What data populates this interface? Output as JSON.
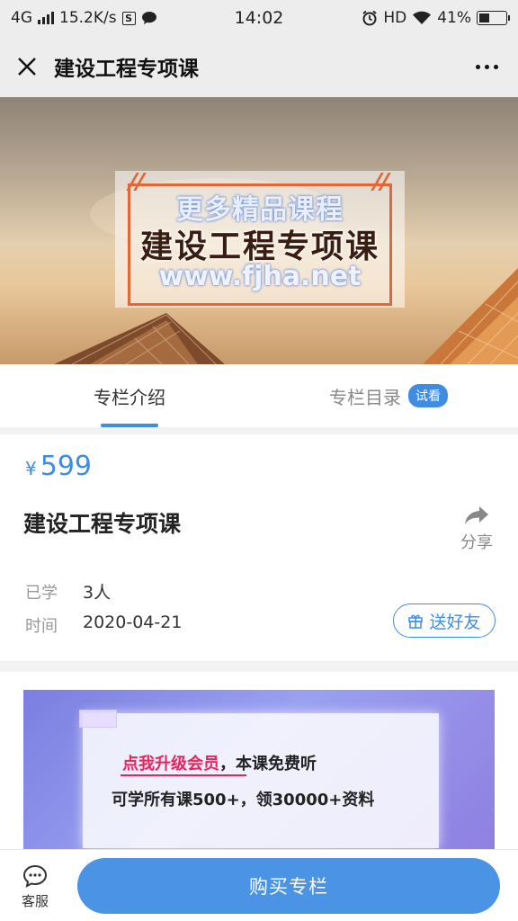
{
  "status_bar": {
    "network": "4G",
    "speed": "15.2K/s",
    "s_icon_label": "S",
    "time": "14:02",
    "hd": "HD",
    "battery": "41%",
    "battery_level": 0.41
  },
  "nav": {
    "title": "建设工程专项课"
  },
  "banner": {
    "line1": "更多精品课程",
    "line2": "建设工程专项课",
    "line3": "www.fjha.net"
  },
  "tabs": {
    "intro": "专栏介绍",
    "catalog": "专栏目录",
    "trial_badge": "试看"
  },
  "course": {
    "currency": "¥",
    "price": "599",
    "title": "建设工程专项课",
    "share_label": "分享",
    "learned_label": "已学",
    "learned_value": "3人",
    "time_label": "时间",
    "time_value": "2020-04-21",
    "gift_label": "送好友"
  },
  "promo": {
    "highlight": "点我升级会员",
    "line1_rest": "，本课免费听",
    "line2": "可学所有课500+，领30000+资料"
  },
  "bottom": {
    "service_label": "客服",
    "buy_label": "购买专栏"
  },
  "colors": {
    "accent": "#3f8de3",
    "promo_highlight": "#e8235d"
  }
}
